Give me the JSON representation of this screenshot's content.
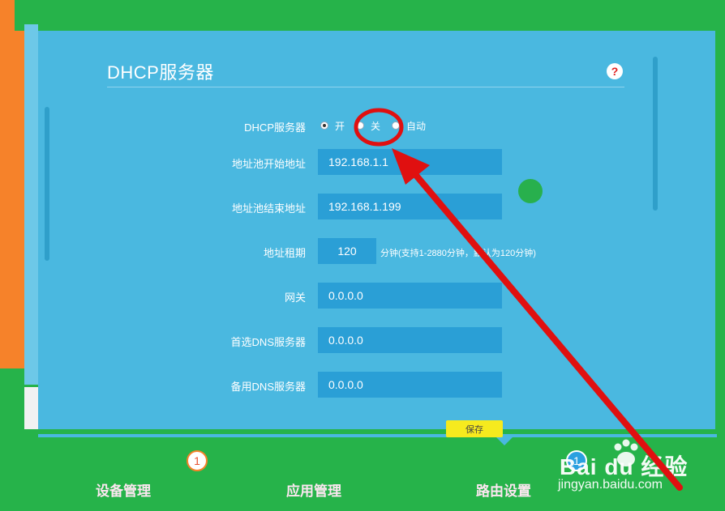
{
  "page": {
    "title": "DHCP服务器",
    "help_icon": "question-icon"
  },
  "form": {
    "dhcp_label": "DHCP服务器",
    "dhcp_options": [
      {
        "label": "开",
        "checked": true
      },
      {
        "label": "关",
        "checked": false
      },
      {
        "label": "自动",
        "checked": false
      }
    ],
    "pool_start_label": "地址池开始地址",
    "pool_start_value": "192.168.1.1",
    "pool_end_label": "地址池结束地址",
    "pool_end_value": "192.168.1.199",
    "lease_label": "地址租期",
    "lease_value": "120",
    "lease_hint": "分钟(支持1-2880分钟，默认为120分钟)",
    "gateway_label": "网关",
    "gateway_value": "0.0.0.0",
    "dns1_label": "首选DNS服务器",
    "dns1_value": "0.0.0.0",
    "dns2_label": "备用DNS服务器",
    "dns2_value": "0.0.0.0",
    "save_label": "保存"
  },
  "nav": {
    "items": [
      {
        "label": "设备管理",
        "badge": "1"
      },
      {
        "label": "应用管理",
        "badge": ""
      },
      {
        "label": "路由设置",
        "badge": "1"
      }
    ]
  },
  "watermark": {
    "brand": "Bai du 经验",
    "url": "jingyan.baidu.com"
  },
  "colors": {
    "panel": "#4ab8e0",
    "field": "#2a9fd6",
    "frame_green": "#26b34a",
    "frame_orange": "#f6822a",
    "save_button": "#f6ea1e",
    "annotation_red": "#e01010"
  }
}
